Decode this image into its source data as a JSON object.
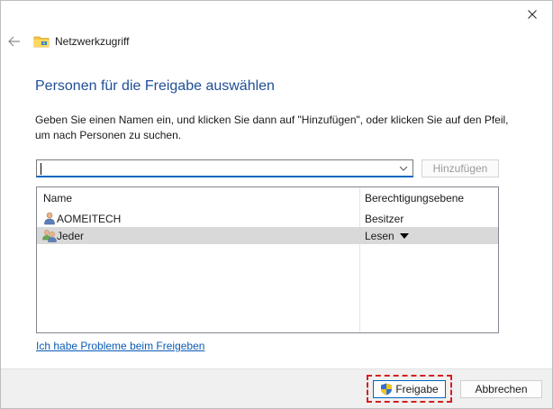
{
  "window": {
    "title": "Netzwerkzugriff"
  },
  "heading": "Personen für die Freigabe auswählen",
  "instructions": "Geben Sie einen Namen ein, und klicken Sie dann auf \"Hinzufügen\", oder klicken Sie auf den Pfeil, um nach Personen zu suchen.",
  "name_input": {
    "value": "",
    "placeholder": ""
  },
  "add_button_label": "Hinzufügen",
  "table": {
    "columns": [
      "Name",
      "Berechtigungsebene"
    ],
    "rows": [
      {
        "name": "AOMEITECH",
        "permission": "Besitzer"
      },
      {
        "name": "Jeder",
        "permission": "Lesen"
      }
    ]
  },
  "help_link": "Ich habe Probleme beim Freigeben",
  "footer": {
    "share_label": "Freigabe",
    "cancel_label": "Abbrechen"
  },
  "colors": {
    "heading": "#1f4e96",
    "link": "#0b5bb5",
    "highlight": "#d61e1e",
    "selected_row": "#d9d9d9"
  },
  "icons": {
    "close": "close-icon",
    "back": "back-arrow-icon",
    "title": "network-folder-icon",
    "dropdown": "chevron-down-icon",
    "user": "user-icon",
    "group": "group-users-icon",
    "permission_dropdown": "caret-down-icon",
    "shield": "uac-shield-icon"
  }
}
